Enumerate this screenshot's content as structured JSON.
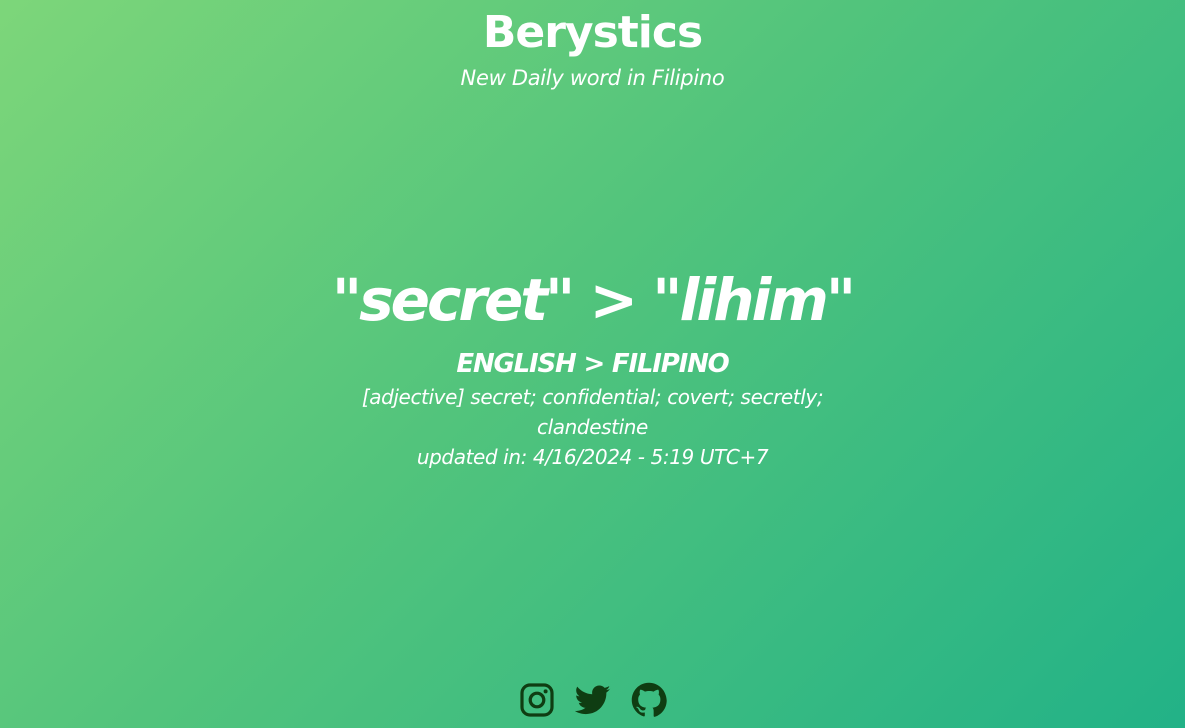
{
  "header": {
    "title": "Berystics",
    "subtitle": "New Daily word in Filipino"
  },
  "word": {
    "pair": "\"secret\" > \"lihim\"",
    "languages": "ENGLISH > FILIPINO",
    "definition": "[adjective] secret; confidential; covert; secretly; clandestine",
    "updated": "updated in: 4/16/2024 - 5:19 UTC+7"
  },
  "socials": [
    {
      "name": "instagram",
      "icon": "instagram-icon"
    },
    {
      "name": "twitter",
      "icon": "twitter-icon"
    },
    {
      "name": "github",
      "icon": "github-icon"
    }
  ],
  "colors": {
    "background_start": "#7dd67a",
    "background_end": "#22b287",
    "text": "#ffffff",
    "icon": "#0f3d12"
  }
}
